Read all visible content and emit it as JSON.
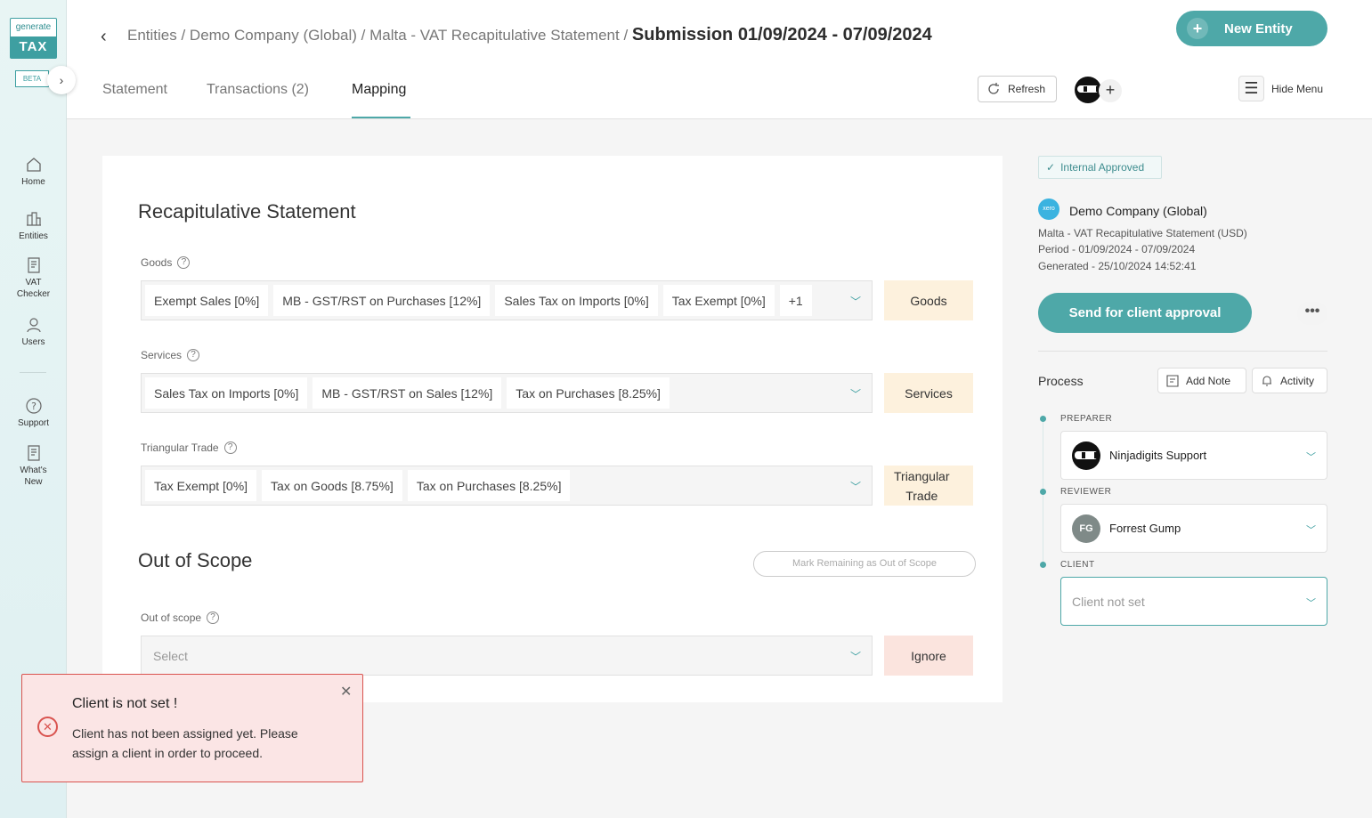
{
  "sidebar": {
    "logo_top": "generate",
    "logo_bottom": "TAX",
    "beta": "BETA",
    "items": [
      {
        "label": "Home"
      },
      {
        "label": "Entities"
      },
      {
        "label": "VAT Checker"
      },
      {
        "label": "Users"
      },
      {
        "label": "Support"
      },
      {
        "label": "What's New"
      }
    ]
  },
  "header": {
    "breadcrumb": "Entities / Demo Company (Global) / Malta - VAT Recapitulative Statement /",
    "current": "Submission 01/09/2024 - 07/09/2024",
    "new_entity": "New Entity",
    "tabs": [
      {
        "label": "Statement"
      },
      {
        "label": "Transactions (2)"
      },
      {
        "label": "Mapping"
      }
    ],
    "active_tab": "Mapping",
    "refresh": "Refresh",
    "hide_menu": "Hide Menu"
  },
  "main": {
    "section1_title": "Recapitulative Statement",
    "fields": [
      {
        "label": "Goods",
        "chips": [
          "Exempt Sales [0%]",
          "MB - GST/RST on Purchases [12%]",
          "Sales Tax on Imports [0%]",
          "Tax Exempt [0%]",
          "+1"
        ],
        "tag": "Goods"
      },
      {
        "label": "Services",
        "chips": [
          "Sales Tax on Imports [0%]",
          "MB - GST/RST on Sales [12%]",
          "Tax on Purchases [8.25%]"
        ],
        "tag": "Services"
      },
      {
        "label": "Triangular Trade",
        "chips": [
          "Tax Exempt [0%]",
          "Tax on Goods [8.75%]",
          "Tax on Purchases [8.25%]"
        ],
        "tag_line1": "Triangular",
        "tag_line2": "Trade"
      }
    ],
    "section2_title": "Out of Scope",
    "mark_remaining": "Mark Remaining as Out of Scope",
    "oos_label": "Out of scope",
    "oos_placeholder": "Select",
    "oos_tag": "Ignore"
  },
  "right": {
    "status": "Internal Approved",
    "xero": "xero",
    "company": "Demo Company (Global)",
    "meta1": "Malta - VAT Recapitulative Statement (USD)",
    "meta2": "Period - 01/09/2024 - 07/09/2024",
    "meta3": "Generated - 25/10/2024 14:52:41",
    "send": "Send for client approval",
    "more": "•••",
    "process": "Process",
    "add_note": "Add Note",
    "activity": "Activity",
    "preparer_role": "PREPARER",
    "preparer": "Ninjadigits Support",
    "reviewer_role": "REVIEWER",
    "reviewer_initials": "FG",
    "reviewer": "Forrest Gump",
    "client_role": "CLIENT",
    "client_placeholder": "Client not set"
  },
  "toast": {
    "title": "Client is not set !",
    "message": "Client has not been assigned yet. Please assign a client in order to proceed."
  },
  "colors": {
    "accent": "#4ea8a8",
    "error": "#d9534f",
    "tag_bg": "#fdf1dd",
    "ignore_bg": "#fbe4de"
  }
}
